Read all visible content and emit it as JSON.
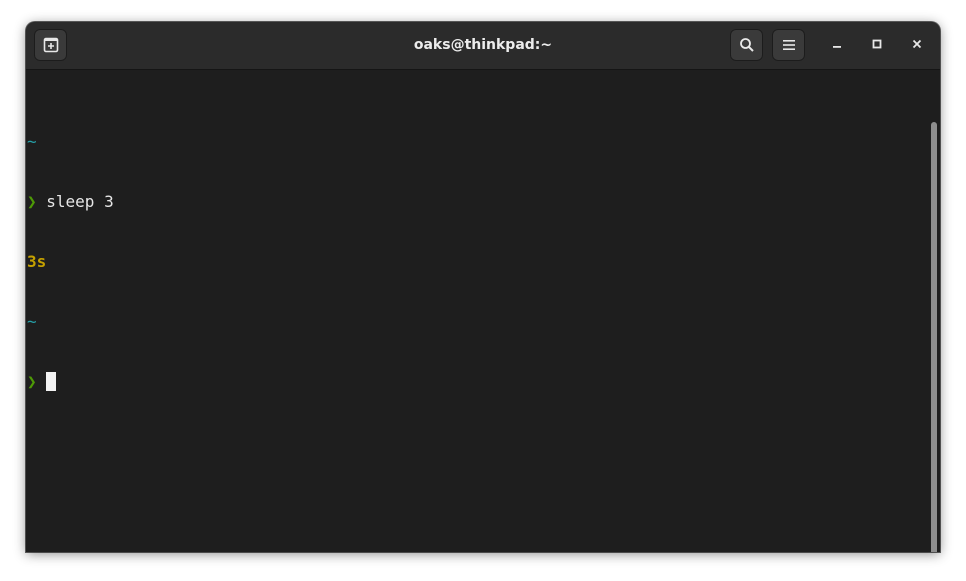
{
  "window": {
    "title": "oaks@thinkpad:~"
  },
  "headerbar": {
    "new_tab_icon": "new-tab-icon",
    "search_icon": "search-icon",
    "menu_icon": "hamburger-menu-icon",
    "minimize_icon": "minimize-icon",
    "maximize_icon": "maximize-icon",
    "close_icon": "close-icon"
  },
  "terminal": {
    "lines": [
      {
        "dir": "~"
      },
      {
        "prompt": "❯",
        "command": " sleep 3"
      },
      {
        "duration": "3s"
      },
      {
        "dir": "~"
      },
      {
        "prompt": "❯",
        "command": " "
      }
    ]
  },
  "colors": {
    "background": "#1e1e1e",
    "headerbar": "#2b2b2b",
    "directory": "#26a0a8",
    "prompt": "#4e9a06",
    "duration": "#c4a000",
    "text": "#e6e6e6"
  }
}
